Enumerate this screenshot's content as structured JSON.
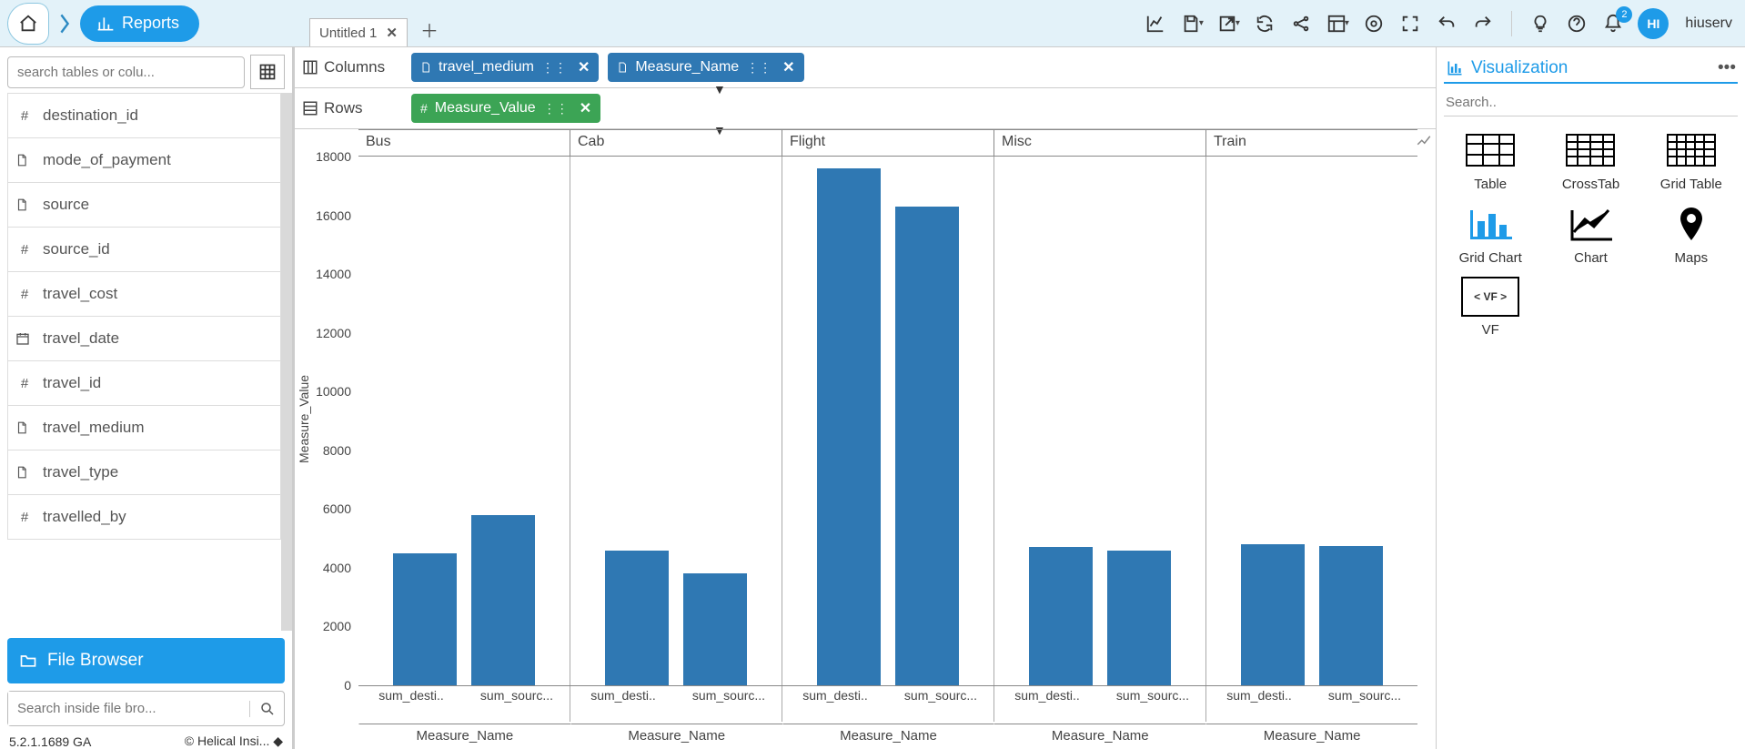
{
  "header": {
    "reports_label": "Reports",
    "doc_tab": "Untitled 1",
    "username": "hiuserv",
    "avatar_initials": "HI",
    "notification_count": "2"
  },
  "sidebar": {
    "search_placeholder": "search tables or colu...",
    "fields": [
      {
        "icon": "#",
        "label": "destination_id"
      },
      {
        "icon": "doc",
        "label": "mode_of_payment"
      },
      {
        "icon": "doc",
        "label": "source"
      },
      {
        "icon": "#",
        "label": "source_id"
      },
      {
        "icon": "#",
        "label": "travel_cost"
      },
      {
        "icon": "cal",
        "label": "travel_date"
      },
      {
        "icon": "#",
        "label": "travel_id"
      },
      {
        "icon": "doc",
        "label": "travel_medium"
      },
      {
        "icon": "doc",
        "label": "travel_type"
      },
      {
        "icon": "#",
        "label": "travelled_by"
      }
    ],
    "file_browser_label": "File Browser",
    "file_search_placeholder": "Search inside file bro...",
    "version": "5.2.1.1689 GA",
    "brand": "Helical Insi..."
  },
  "shelves": {
    "columns_label": "Columns",
    "rows_label": "Rows",
    "column_pills": [
      {
        "icon": "doc",
        "label": "travel_medium"
      },
      {
        "icon": "doc",
        "label": "Measure_Name"
      }
    ],
    "row_pills": [
      {
        "icon": "#",
        "label": "Measure_Value"
      }
    ]
  },
  "right": {
    "title": "Visualization",
    "search_placeholder": "Search..",
    "items": [
      "Table",
      "CrossTab",
      "Grid Table",
      "Grid Chart",
      "Chart",
      "Maps",
      "VF"
    ]
  },
  "chart_data": {
    "type": "bar",
    "ylabel": "Measure_Value",
    "xlabel": "Measure_Name",
    "ylim": [
      0,
      18000
    ],
    "yticks": [
      0,
      2000,
      4000,
      6000,
      8000,
      10000,
      12000,
      14000,
      16000,
      18000
    ],
    "facets": [
      "Bus",
      "Cab",
      "Flight",
      "Misc",
      "Train"
    ],
    "sub_categories": [
      "sum_desti..",
      "sum_sourc..."
    ],
    "series": [
      {
        "facet": "Bus",
        "values": [
          4500,
          5800
        ]
      },
      {
        "facet": "Cab",
        "values": [
          4600,
          3800
        ]
      },
      {
        "facet": "Flight",
        "values": [
          17600,
          16300
        ]
      },
      {
        "facet": "Misc",
        "values": [
          4700,
          4600
        ]
      },
      {
        "facet": "Train",
        "values": [
          4800,
          4750
        ]
      }
    ]
  }
}
